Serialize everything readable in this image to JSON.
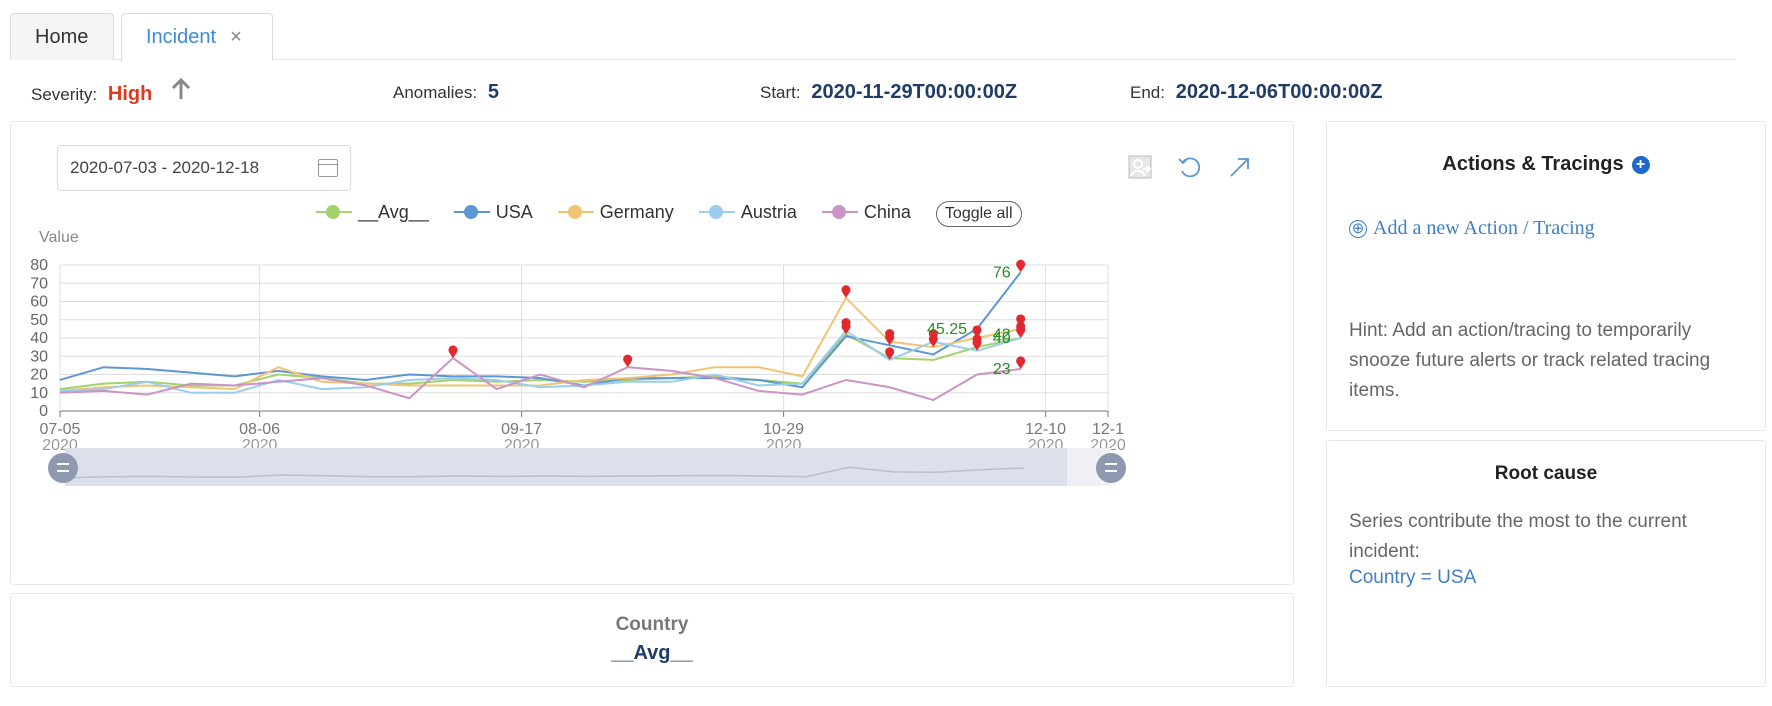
{
  "tabs": [
    {
      "label": "Home"
    },
    {
      "label": "Incident",
      "close": "×"
    }
  ],
  "meta": {
    "severity_label": "Severity:",
    "severity_value": "High",
    "anomalies_label": "Anomalies:",
    "anomalies_value": "5",
    "start_label": "Start:",
    "start_value": "2020-11-29T00:00:00Z",
    "end_label": "End:",
    "end_value": "2020-12-06T00:00:00Z"
  },
  "chart_toolbar": {
    "date_range": "2020-07-03 - 2020-12-18",
    "toggle_all": "Toggle all"
  },
  "chart_data": {
    "type": "line",
    "ylabel": "Value",
    "ylim": [
      0,
      80
    ],
    "yticks": [
      "0",
      "10",
      "20",
      "30",
      "40",
      "50",
      "60",
      "70",
      "80"
    ],
    "xticks": [
      {
        "day": 0,
        "top": "07-05",
        "bottom": "2020"
      },
      {
        "day": 32,
        "top": "08-06",
        "bottom": "2020"
      },
      {
        "day": 74,
        "top": "09-17",
        "bottom": "2020"
      },
      {
        "day": 116,
        "top": "10-29",
        "bottom": "2020"
      },
      {
        "day": 158,
        "top": "12-10",
        "bottom": "2020"
      },
      {
        "day": 168,
        "top": "12-1",
        "bottom": "2020"
      }
    ],
    "x": [
      0,
      7,
      14,
      21,
      28,
      35,
      42,
      49,
      56,
      63,
      70,
      77,
      84,
      91,
      98,
      105,
      112,
      119,
      126,
      133,
      140,
      147,
      154
    ],
    "series": [
      {
        "name": "__Avg__",
        "color": "#a3d16b",
        "values": [
          12,
          15,
          16,
          14,
          14,
          20,
          18,
          15,
          15,
          17,
          16,
          17,
          16,
          17,
          18,
          19,
          17,
          15,
          42,
          29,
          28,
          35,
          40
        ]
      },
      {
        "name": "USA",
        "color": "#5c97d4",
        "values": [
          17,
          24,
          23,
          21,
          19,
          22,
          19,
          17,
          20,
          19,
          19,
          18,
          14,
          18,
          18,
          18,
          17,
          13,
          41,
          36,
          31,
          45,
          76
        ]
      },
      {
        "name": "Germany",
        "color": "#f2c372",
        "values": [
          11,
          13,
          14,
          13,
          12,
          24,
          16,
          15,
          14,
          14,
          14,
          14,
          17,
          18,
          20,
          24,
          24,
          19,
          62,
          38,
          35,
          40,
          45
        ]
      },
      {
        "name": "Austria",
        "color": "#9bcdef",
        "values": [
          11,
          12,
          16,
          10,
          10,
          17,
          12,
          13,
          17,
          18,
          17,
          13,
          14,
          16,
          16,
          20,
          14,
          15,
          44,
          28,
          38,
          33,
          40
        ]
      },
      {
        "name": "China",
        "color": "#cc93c7",
        "values": [
          10,
          11,
          9,
          15,
          14,
          16,
          18,
          14,
          7,
          29,
          12,
          20,
          13,
          24,
          22,
          18,
          11,
          9,
          17,
          13,
          6,
          20,
          23
        ]
      }
    ],
    "anomalies": [
      {
        "x": 63,
        "y": 29
      },
      {
        "x": 91,
        "y": 24
      },
      {
        "x": 126,
        "y": 62
      },
      {
        "x": 126,
        "y": 44
      },
      {
        "x": 126,
        "y": 42
      },
      {
        "x": 133,
        "y": 38
      },
      {
        "x": 133,
        "y": 36
      },
      {
        "x": 133,
        "y": 28
      },
      {
        "x": 140,
        "y": 38
      },
      {
        "x": 140,
        "y": 35
      },
      {
        "x": 147,
        "y": 40
      },
      {
        "x": 147,
        "y": 35
      },
      {
        "x": 147,
        "y": 33
      },
      {
        "x": 154,
        "y": 76
      },
      {
        "x": 154,
        "y": 46
      },
      {
        "x": 154,
        "y": 42
      },
      {
        "x": 154,
        "y": 40
      },
      {
        "x": 154,
        "y": 23
      }
    ],
    "data_labels": [
      {
        "x": 154,
        "y": 76,
        "text": "76"
      },
      {
        "x": 154,
        "y": 23,
        "text": "23"
      },
      {
        "x": 147,
        "y": 45,
        "text": "45.25"
      },
      {
        "x": 154,
        "y": 40,
        "text": "40"
      },
      {
        "x": 154,
        "y": 42,
        "text": "42"
      }
    ],
    "grid": true,
    "legend": "top-center",
    "zoom_slider": true
  },
  "country": {
    "title": "Country",
    "value": "__Avg__"
  },
  "actions": {
    "title": "Actions & Tracings",
    "plus": "+",
    "add_icon": "⊕",
    "add_link": "Add a new Action / Tracing",
    "hint": "Hint: Add an action/tracing to temporarily snooze future alerts or track related tracing items."
  },
  "root_cause": {
    "title": "Root cause",
    "description": "Series contribute the most to the current incident:",
    "link": "Country = USA"
  }
}
